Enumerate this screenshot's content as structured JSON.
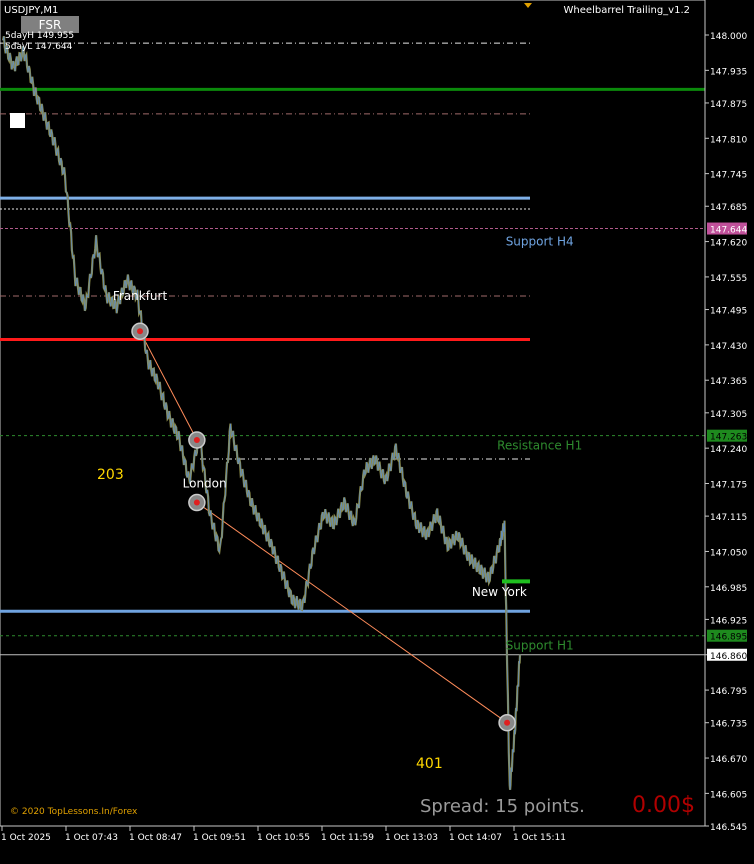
{
  "window": {
    "symbol_label": "USDJPY,M1",
    "indicator_label": "Wheelbarrel Trailing_v1.2",
    "fsr_button": "FSR",
    "day_high": "5dayH 149.955",
    "day_low": "5dayL 147.644",
    "copyright": "© 2020 TopLessons.In/Forex",
    "spread_text": "Spread: 15 points.",
    "profit_text": "0.00$",
    "count_left": "203",
    "count_right": "401"
  },
  "colors": {
    "background": "#000000",
    "candles": "#8a8a4a",
    "candle_up": "#5b8fd6",
    "green_line": "#0b8a0b",
    "blue_level": "#7fb0e8",
    "red_level": "#ff1a1a",
    "support_blue": "#6fa3e0",
    "green_dash": "#2e8b2e",
    "orange_line": "#ff8c5a",
    "count_yellow": "#ffd700",
    "spread_gray": "#9a9a9a",
    "profit_red": "#b00000"
  },
  "chart_data": {
    "type": "line",
    "title": "USDJPY,M1",
    "ylim": [
      146.545,
      148.025
    ],
    "y_ticks": [
      "148.000",
      "147.935",
      "147.875",
      "147.810",
      "147.745",
      "147.685",
      "147.620",
      "147.555",
      "147.495",
      "147.430",
      "147.365",
      "147.305",
      "147.240",
      "147.175",
      "147.115",
      "147.050",
      "146.985",
      "146.925",
      "146.860",
      "146.795",
      "146.735",
      "146.670",
      "146.605",
      "146.545"
    ],
    "x_ticks": [
      "1 Oct 2025",
      "1 Oct 07:43",
      "1 Oct 08:47",
      "1 Oct 09:51",
      "1 Oct 10:55",
      "1 Oct 11:59",
      "1 Oct 13:03",
      "1 Oct 14:07",
      "1 Oct 15:11"
    ],
    "price_path": [
      {
        "t": 0.0,
        "p": 147.99
      },
      {
        "t": 0.02,
        "p": 147.94
      },
      {
        "t": 0.04,
        "p": 147.97
      },
      {
        "t": 0.06,
        "p": 147.9
      },
      {
        "t": 0.08,
        "p": 147.85
      },
      {
        "t": 0.1,
        "p": 147.8
      },
      {
        "t": 0.12,
        "p": 147.74
      },
      {
        "t": 0.14,
        "p": 147.55
      },
      {
        "t": 0.16,
        "p": 147.5
      },
      {
        "t": 0.18,
        "p": 147.62
      },
      {
        "t": 0.2,
        "p": 147.52
      },
      {
        "t": 0.22,
        "p": 147.5
      },
      {
        "t": 0.24,
        "p": 147.55
      },
      {
        "t": 0.26,
        "p": 147.52
      },
      {
        "t": 0.28,
        "p": 147.4
      },
      {
        "t": 0.3,
        "p": 147.36
      },
      {
        "t": 0.32,
        "p": 147.3
      },
      {
        "t": 0.34,
        "p": 147.26
      },
      {
        "t": 0.36,
        "p": 147.18
      },
      {
        "t": 0.38,
        "p": 147.26
      },
      {
        "t": 0.4,
        "p": 147.12
      },
      {
        "t": 0.42,
        "p": 147.05
      },
      {
        "t": 0.44,
        "p": 147.28
      },
      {
        "t": 0.46,
        "p": 147.2
      },
      {
        "t": 0.48,
        "p": 147.14
      },
      {
        "t": 0.5,
        "p": 147.1
      },
      {
        "t": 0.52,
        "p": 147.06
      },
      {
        "t": 0.54,
        "p": 147.01
      },
      {
        "t": 0.56,
        "p": 146.96
      },
      {
        "t": 0.58,
        "p": 146.95
      },
      {
        "t": 0.6,
        "p": 147.05
      },
      {
        "t": 0.62,
        "p": 147.12
      },
      {
        "t": 0.64,
        "p": 147.1
      },
      {
        "t": 0.66,
        "p": 147.14
      },
      {
        "t": 0.68,
        "p": 147.1
      },
      {
        "t": 0.7,
        "p": 147.2
      },
      {
        "t": 0.72,
        "p": 147.22
      },
      {
        "t": 0.74,
        "p": 147.18
      },
      {
        "t": 0.76,
        "p": 147.24
      },
      {
        "t": 0.78,
        "p": 147.16
      },
      {
        "t": 0.8,
        "p": 147.1
      },
      {
        "t": 0.82,
        "p": 147.08
      },
      {
        "t": 0.84,
        "p": 147.12
      },
      {
        "t": 0.86,
        "p": 147.06
      },
      {
        "t": 0.88,
        "p": 147.08
      },
      {
        "t": 0.9,
        "p": 147.04
      },
      {
        "t": 0.92,
        "p": 147.02
      },
      {
        "t": 0.94,
        "p": 147.0
      },
      {
        "t": 0.96,
        "p": 147.06
      },
      {
        "t": 0.97,
        "p": 147.1
      },
      {
        "t": 0.98,
        "p": 146.61
      },
      {
        "t": 0.99,
        "p": 146.72
      },
      {
        "t": 1.0,
        "p": 146.86
      }
    ],
    "levels": [
      {
        "name": "green-top-line",
        "price": 147.9,
        "style": "solid-green"
      },
      {
        "name": "dashdot-white-top",
        "price": 147.985,
        "style": "dashdot-white"
      },
      {
        "name": "dashdot-dim-top",
        "price": 147.855,
        "style": "dashdot-dim"
      },
      {
        "name": "light-blue-level",
        "price": 147.7,
        "style": "solid-lightblue"
      },
      {
        "name": "dotted-white-level",
        "price": 147.68,
        "style": "dotted-white"
      },
      {
        "name": "pink-dash-level",
        "price": 147.644,
        "style": "dash-pink"
      },
      {
        "name": "dashdot-mid",
        "price": 147.52,
        "style": "dashdot-dim"
      },
      {
        "name": "red-level",
        "price": 147.44,
        "style": "solid-red"
      },
      {
        "name": "resistance-h1",
        "price": 147.263,
        "style": "dash-green",
        "label": "Resistance H1"
      },
      {
        "name": "dashdot-london",
        "price": 147.22,
        "style": "dashdot-white"
      },
      {
        "name": "support-blue-level",
        "price": 146.94,
        "style": "solid-blue"
      },
      {
        "name": "support-h1",
        "price": 146.895,
        "style": "dash-green",
        "label": "Support H1"
      },
      {
        "name": "current-price",
        "price": 146.86,
        "style": "solid-gray"
      }
    ],
    "price_tags": [
      {
        "price": 147.644,
        "label": "147.644",
        "style": "pink"
      },
      {
        "price": 147.263,
        "label": "147.263",
        "style": "green"
      },
      {
        "price": 146.895,
        "label": "146.895",
        "style": "green"
      },
      {
        "price": 146.86,
        "label": "146.860",
        "style": "white"
      }
    ],
    "sessions": [
      {
        "label": "Frankfurt",
        "t": 0.265,
        "p": 147.52
      },
      {
        "label": "London",
        "t": 0.39,
        "p": 147.175
      },
      {
        "label": "New York",
        "t": 0.96,
        "p": 146.975
      }
    ],
    "zone_labels": [
      {
        "label": "Support H4",
        "t": 0.98,
        "p": 147.62
      },
      {
        "label": "Resistance H1",
        "t": 0.98,
        "p": 147.245
      },
      {
        "label": "Support H1",
        "t": 0.98,
        "p": 146.877
      }
    ],
    "swing_points": [
      {
        "t": 0.265,
        "p": 147.455
      },
      {
        "t": 0.375,
        "p": 147.255
      },
      {
        "t": 0.375,
        "p": 147.14
      },
      {
        "t": 0.975,
        "p": 146.735
      }
    ]
  }
}
